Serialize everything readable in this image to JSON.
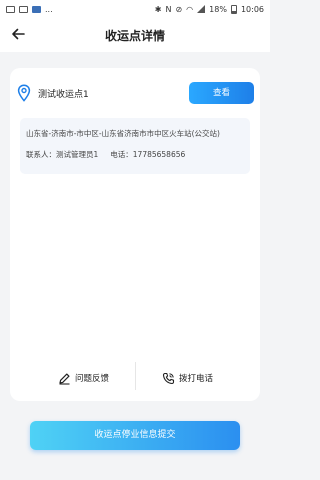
{
  "status_bar": {
    "overflow": "...",
    "battery": "18%",
    "time": "10:06",
    "network": "N"
  },
  "nav": {
    "title": "收运点详情"
  },
  "point": {
    "name": "测试收运点1",
    "view_label": "查看",
    "address": "山东省-济南市-市中区-山东省济南市市中区火车站(公交站)",
    "contact_label": "联系人：测试管理员1",
    "phone_label": "电话：17785658656"
  },
  "actions": {
    "feedback_label": "问题反馈",
    "call_label": "拨打电话"
  },
  "footer": {
    "submit_label": "收运点停业信息提交"
  },
  "colors": {
    "accent": "#1e7fe8",
    "accent_light": "#4fd2f5",
    "background": "#f3f4f6",
    "card": "#ffffff",
    "address_box": "#f3f6fb"
  }
}
